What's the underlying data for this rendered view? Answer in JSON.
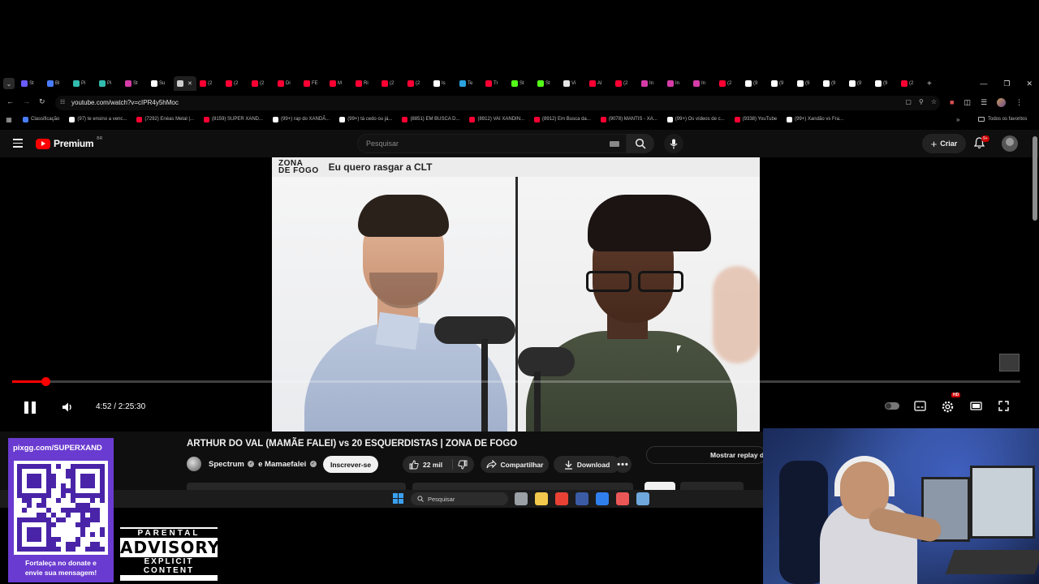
{
  "browser": {
    "tabs": [
      {
        "label": "St",
        "color": "#6b5cff"
      },
      {
        "label": "Bl",
        "color": "#4a7cff"
      },
      {
        "label": "Pi",
        "color": "#32bcad"
      },
      {
        "label": "Pi",
        "color": "#32bcad"
      },
      {
        "label": "St",
        "color": "#d63ca8"
      },
      {
        "label": "Su",
        "color": "#ffffff"
      },
      {
        "label": "",
        "color": "#cccccc",
        "active": true
      },
      {
        "label": "(2",
        "color": "#ff0033"
      },
      {
        "label": "(2",
        "color": "#ff0033"
      },
      {
        "label": "(2",
        "color": "#ff0033"
      },
      {
        "label": "Di",
        "color": "#ff0033"
      },
      {
        "label": "FE",
        "color": "#ff0033"
      },
      {
        "label": "M",
        "color": "#ff0033"
      },
      {
        "label": "Ri",
        "color": "#ff0033"
      },
      {
        "label": "(2",
        "color": "#ff0033"
      },
      {
        "label": "(2",
        "color": "#ff0033"
      },
      {
        "label": "Is",
        "color": "#ffffff"
      },
      {
        "label": "Te",
        "color": "#2aa3e0"
      },
      {
        "label": "Tr",
        "color": "#ff0033"
      },
      {
        "label": "St",
        "color": "#53fc18"
      },
      {
        "label": "St",
        "color": "#53fc18"
      },
      {
        "label": "Vi",
        "color": "#e6e6e6"
      },
      {
        "label": "Al",
        "color": "#ff0033"
      },
      {
        "label": "(2",
        "color": "#ff0033"
      },
      {
        "label": "In",
        "color": "#d63ca8"
      },
      {
        "label": "In",
        "color": "#d63ca8"
      },
      {
        "label": "In",
        "color": "#d63ca8"
      },
      {
        "label": "(2",
        "color": "#ff0033"
      },
      {
        "label": "(9",
        "color": "#ffffff"
      },
      {
        "label": "(9",
        "color": "#ffffff"
      },
      {
        "label": "(9",
        "color": "#ffffff"
      },
      {
        "label": "(9",
        "color": "#ffffff"
      },
      {
        "label": "(9",
        "color": "#ffffff"
      },
      {
        "label": "(9",
        "color": "#ffffff"
      },
      {
        "label": "(2",
        "color": "#ff0033"
      }
    ],
    "url": "youtube.com/watch?v=cIPR4y5hMoc",
    "bookmarks": [
      {
        "label": "Classificação",
        "color": "#4a7cff"
      },
      {
        "label": "(97) te ensino a venc...",
        "color": "#ffffff"
      },
      {
        "label": "(7292) Enéas Metal |...",
        "color": "#ff0033"
      },
      {
        "label": "(8159) SUPER XAND...",
        "color": "#ff0033"
      },
      {
        "label": "(99+) rap do XANDÃ...",
        "color": "#ffffff"
      },
      {
        "label": "(99+) tá cedo ou já...",
        "color": "#ffffff"
      },
      {
        "label": "(8851) EM BUSCA D...",
        "color": "#ff0033"
      },
      {
        "label": "(8912) VAI XANDIN...",
        "color": "#ff0033"
      },
      {
        "label": "(8912) Em Busca da...",
        "color": "#ff0033"
      },
      {
        "label": "(9078) MANTIS - XA...",
        "color": "#ff0033"
      },
      {
        "label": "(99+) Os vídeos de c...",
        "color": "#ffffff"
      },
      {
        "label": "(9338) YouTube",
        "color": "#ff0033"
      },
      {
        "label": "(99+) Xandão vs Fra...",
        "color": "#ffffff"
      }
    ],
    "all_bookmarks_label": "Todos os favoritos"
  },
  "youtube": {
    "brand": "Premium",
    "region": "BR",
    "search_placeholder": "Pesquisar",
    "create_label": "Criar",
    "notif_badge": "9+"
  },
  "video": {
    "banner_logo_line1": "ZONA",
    "banner_logo_line2": "DE FOGO",
    "banner_title": "Eu quero rasgar a CLT",
    "time_display": "4:52 / 2:25:30",
    "progress_fraction": 0.0334,
    "hd_badge": "HD"
  },
  "details": {
    "title": "ARTHUR DO VAL (MAMÃE FALEI) vs 20 ESQUERDISTAS | ZONA DE FOGO",
    "channel1": "Spectrum",
    "channel_joiner": "e",
    "channel2": "Mamaefalei",
    "subscribe_label": "Inscrever-se",
    "likes": "22 mil",
    "share_label": "Compartilhar",
    "download_label": "Download",
    "replay_label": "Mostrar replay do"
  },
  "taskbar": {
    "search_placeholder": "Pesquisar",
    "apps": [
      {
        "name": "task-view",
        "color": "#9aa0a6"
      },
      {
        "name": "file-explorer",
        "color": "#f2c94c"
      },
      {
        "name": "chrome",
        "color": "#e94235"
      },
      {
        "name": "steam",
        "color": "#3b5ba5"
      },
      {
        "name": "app-blue",
        "color": "#2f80ed"
      },
      {
        "name": "app-red",
        "color": "#eb5757"
      },
      {
        "name": "settings",
        "color": "#6fa8dc"
      }
    ]
  },
  "overlay": {
    "pix_url": "pixgg.com/SUPERXAND",
    "pix_caption_line1": "Fortaleça no donate e",
    "pix_caption_line2": "envie sua mensagem!",
    "advisory_top": "PARENTAL",
    "advisory_mid": "ADVISORY",
    "advisory_bottom": "EXPLICIT CONTENT"
  },
  "colors": {
    "yt_red": "#ff0000",
    "pix_purple": "#6a3bd0"
  }
}
